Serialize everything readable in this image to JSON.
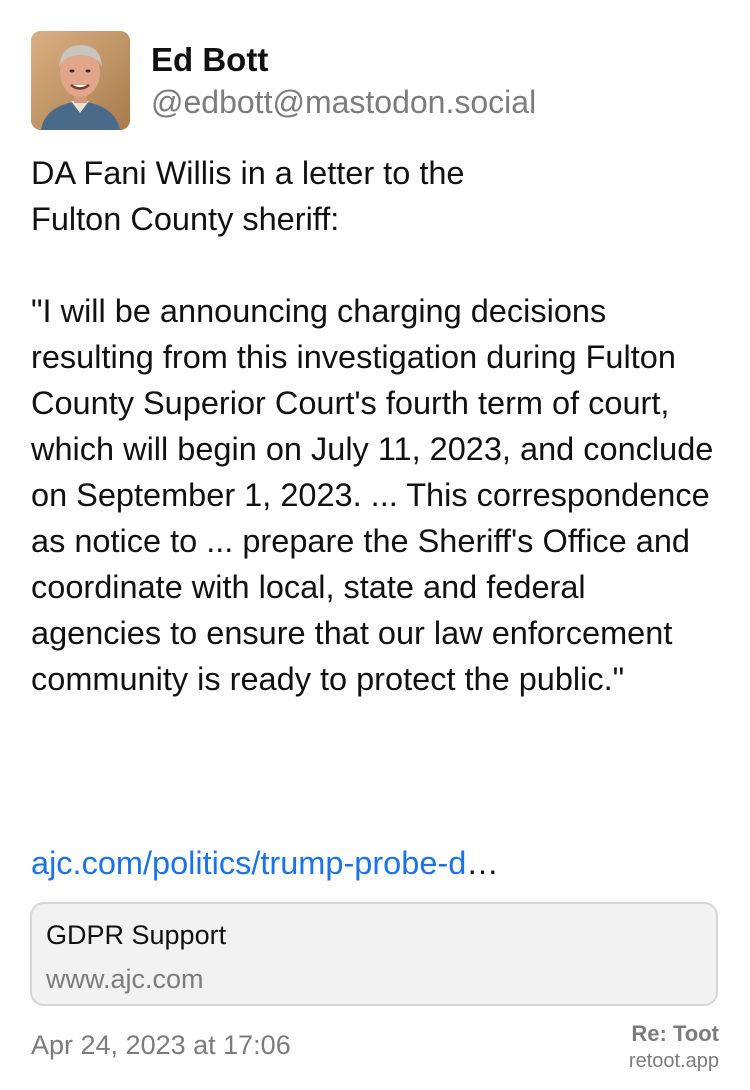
{
  "author": {
    "display_name": "Ed Bott",
    "handle": "@edbott@mastodon.social",
    "avatar_icon": "user-avatar-photo"
  },
  "post": {
    "paragraphs": [
      "DA Fani Willis in a letter to the\nFulton County sheriff:",
      "\"I will be announcing charging decisions resulting from this investigation during Fulton County Superior Court's fourth term of court, which will begin on July 11, 2023, and conclude on September 1, 2023. ... This correspondence as notice to ... prepare the Sheriff's Office and coordinate with local, state and federal agencies to ensure that our law enforcement community is ready to protect the public.\""
    ],
    "link_text": "ajc.com/politics/trump-probe-d",
    "link_ellipsis": "…",
    "timestamp": "Apr 24, 2023 at 17:06"
  },
  "link_card": {
    "title": "GDPR Support",
    "domain": "www.ajc.com"
  },
  "branding": {
    "name": "Re: Toot",
    "site": "retoot.app"
  },
  "colors": {
    "link": "#1a73e8",
    "muted": "#7c7c7c",
    "card_background": "#f2f2f2",
    "card_border": "#d6d6d6"
  }
}
